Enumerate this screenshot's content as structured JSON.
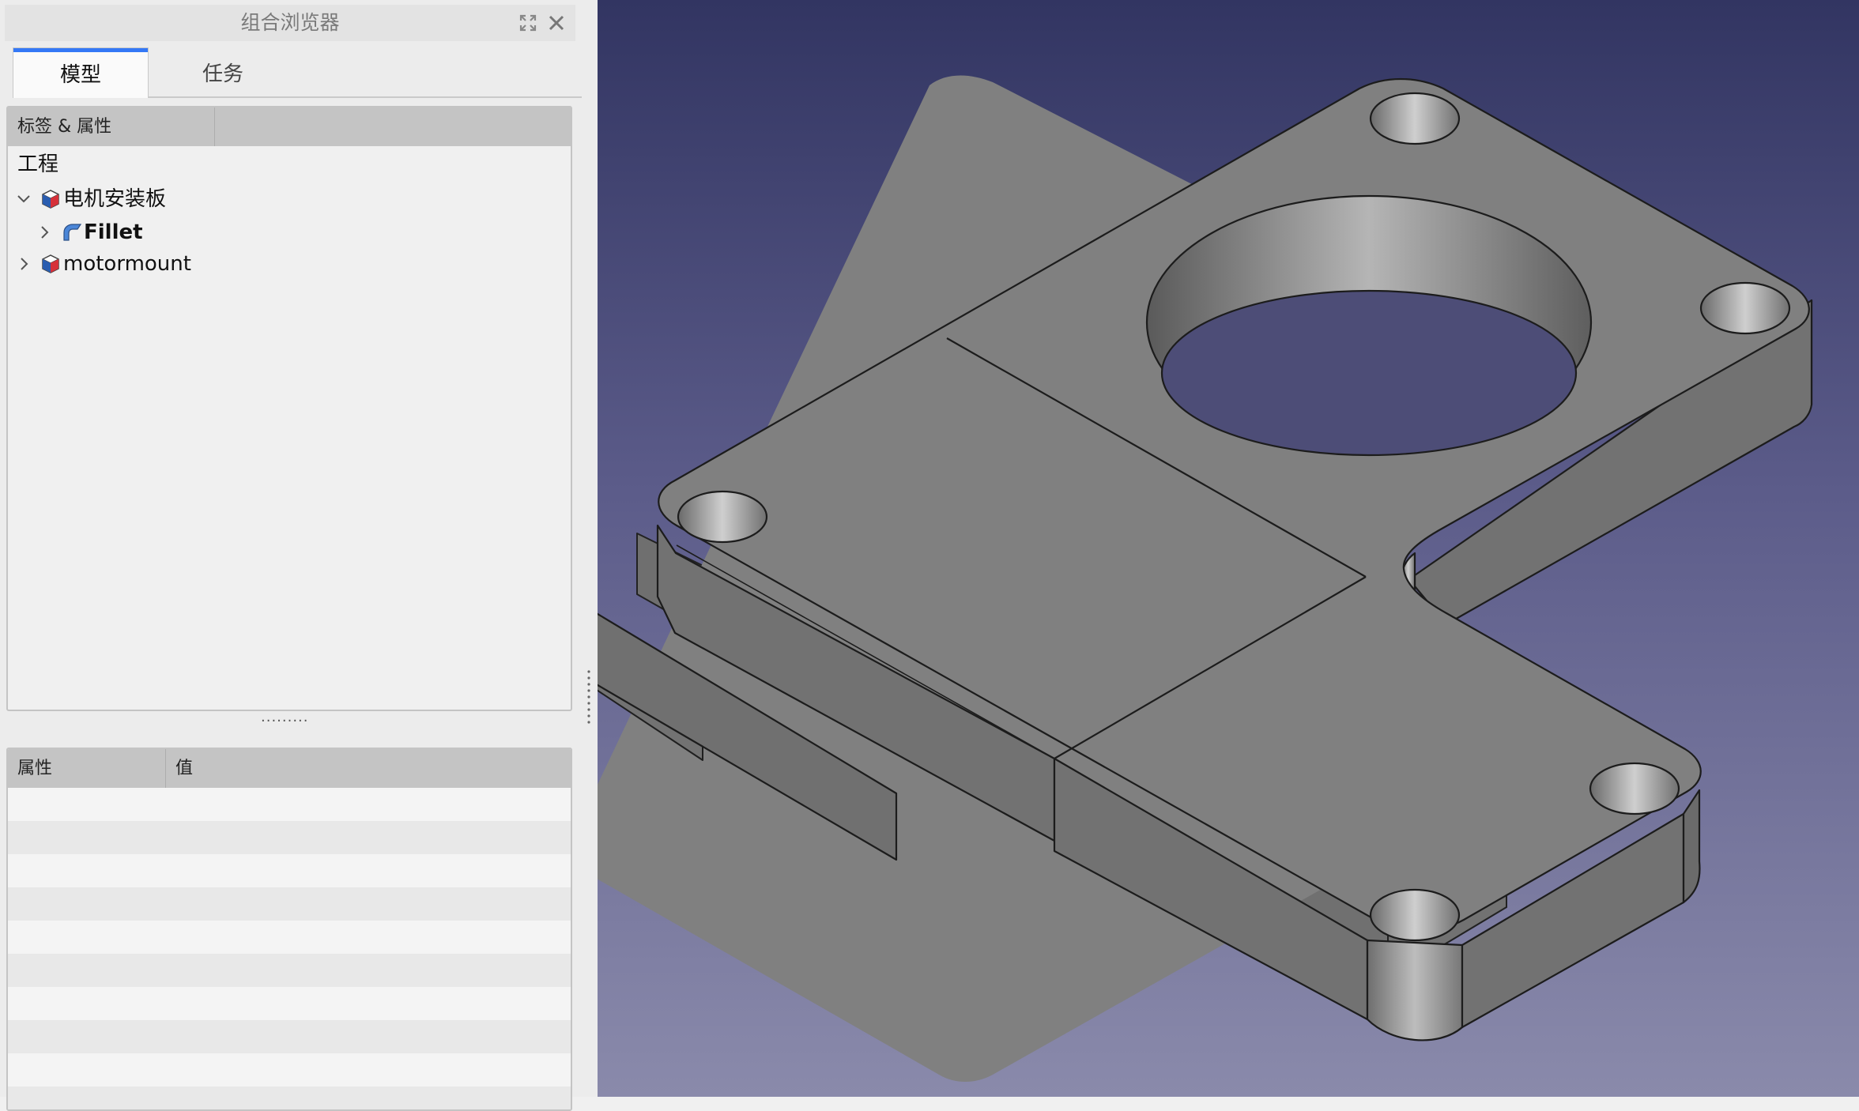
{
  "combo_view": {
    "title": "组合浏览器",
    "tabs": [
      {
        "label": "模型",
        "active": true
      },
      {
        "label": "任务",
        "active": false
      }
    ],
    "tree": {
      "column_header": "标签 & 属性",
      "root_label": "工程",
      "items": [
        {
          "label": "电机安装板",
          "expanded": true,
          "icon": "part-body-icon"
        },
        {
          "label": "Fillet",
          "bold": true,
          "icon": "fillet-icon"
        },
        {
          "label": "motormount",
          "expanded": false,
          "icon": "part-body-icon"
        }
      ]
    },
    "splitter_text": "·········",
    "properties": {
      "column_property": "属性",
      "column_value": "值"
    }
  },
  "colors": {
    "tab_accent": "#3478f6",
    "viewport_top": "#323562",
    "viewport_bottom": "#8a8aab",
    "model_face": "#808080"
  }
}
